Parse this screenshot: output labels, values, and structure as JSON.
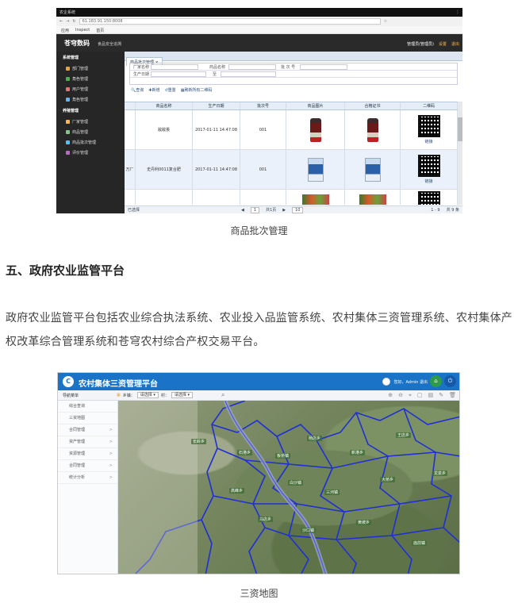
{
  "shot1": {
    "window_title": "农企系统",
    "address": "61.183.91.150:8008",
    "bookmarks": [
      "应用",
      "Inspect",
      "首页"
    ],
    "brand": "苍穹数码",
    "brand_sub": "食品安全追溯",
    "user_link": "管理员(管理员)",
    "settings_link": "设置",
    "logout_link": "退出",
    "sidebar": {
      "group1": "系统管理",
      "items1": [
        "部门管理",
        "角色管理",
        "用户管理",
        "角色管理"
      ],
      "group2": "养殖管理",
      "items2": [
        "厂家管理",
        "商品管理",
        "商品批次管理",
        "评价管理"
      ]
    },
    "tab": "商品批次管理",
    "form": {
      "factory_label": "厂家名称",
      "product_label": "商品名称",
      "batch_label": "批 次 号",
      "date_label": "生产日期",
      "to_label": "至"
    },
    "tools": [
      "查询",
      "新增",
      "重置",
      "刷新所有二维码"
    ],
    "columns": [
      "",
      "商品名称",
      "生产日期",
      "批次号",
      "商品图片",
      "合格证书",
      "二维码"
    ],
    "rows": [
      {
        "factory": "",
        "name": "敌敌畏",
        "date": "2017-01-11 14:47:08",
        "batch": "001",
        "qr_label": "链接"
      },
      {
        "factory": "万厂",
        "name": "史丹利0011复合肥",
        "date": "2017-01-11 14:47:08",
        "batch": "001",
        "qr_label": "链接"
      },
      {
        "factory": "",
        "name": "",
        "date": "",
        "batch": "",
        "qr_label": ""
      }
    ],
    "footer": {
      "selected": "已选择",
      "page": "1",
      "total_pages": "共1页",
      "page_size": "10",
      "range": "1 - 9",
      "total": "共 9 条"
    }
  },
  "caption1": "商品批次管理",
  "heading": "五、政府农业监管平台",
  "paragraph": "政府农业监管平台包括农业综合执法系统、农业投入品监管系统、农村集体三资管理系统、农村集体产权改革综合管理系统和苍穹农村综合产权交易平台。",
  "shot2": {
    "title": "农村集体三资管理平台",
    "user": "您好，Admin 退出",
    "nav_header": "导航菜单",
    "township_label": "乡镇：",
    "township_value": "请选择",
    "village_label": "村：",
    "village_value": "请选择",
    "menu": [
      {
        "label": "综合查询",
        "arrow": ""
      },
      {
        "label": "三资地图",
        "arrow": ""
      },
      {
        "label": "合同管理",
        "arrow": ">"
      },
      {
        "label": "资产管理",
        "arrow": ">"
      },
      {
        "label": "资源管理",
        "arrow": ">"
      },
      {
        "label": "合同管理",
        "arrow": ">"
      },
      {
        "label": "统计分析",
        "arrow": ">"
      }
    ],
    "map_labels": [
      "长岭乡",
      "石港乡",
      "板桥镇",
      "杨店乡",
      "新港乡",
      "王店乡",
      "龙泉乡",
      "高峰乡",
      "白沙镇",
      "三河镇",
      "大桥乡",
      "马店乡",
      "沙口镇",
      "黄坡乡",
      "庙前镇"
    ],
    "colors": {
      "accent": "#1b73c8",
      "boundary": "#1f2fd6"
    }
  },
  "caption2": "三资地图"
}
